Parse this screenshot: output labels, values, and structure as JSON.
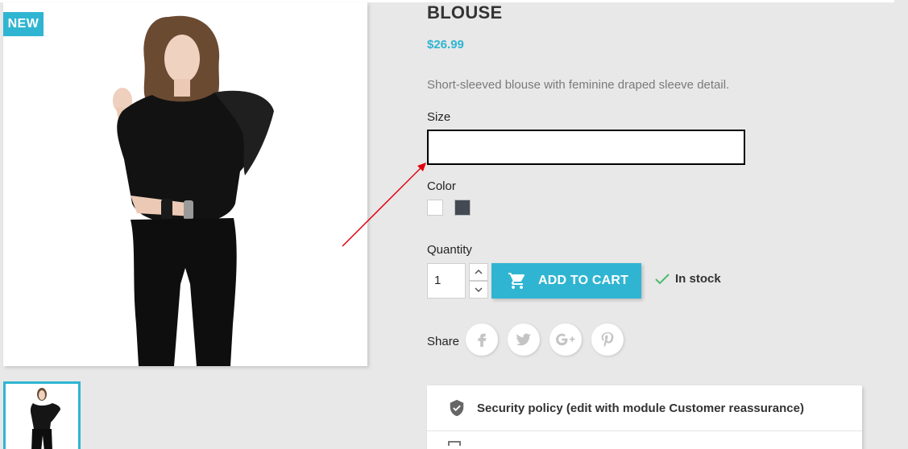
{
  "product": {
    "flag": "NEW",
    "title": "BLOUSE",
    "price": "$26.99",
    "short_description": "Short-sleeved blouse with feminine draped sleeve detail."
  },
  "variants": {
    "size_label": "Size",
    "size_value": "",
    "color_label": "Color",
    "colors": [
      {
        "name": "white",
        "hex": "#ffffff"
      },
      {
        "name": "dark-grey",
        "hex": "#434a54"
      }
    ]
  },
  "purchase": {
    "quantity_label": "Quantity",
    "quantity_value": "1",
    "add_to_cart_label": "ADD TO CART",
    "stock_status": "In stock"
  },
  "share": {
    "label": "Share",
    "networks": [
      "facebook-icon",
      "twitter-icon",
      "google-plus-icon",
      "pinterest-icon"
    ]
  },
  "reassurance": {
    "items": [
      {
        "text": "Security policy (edit with module Customer reassurance)",
        "icon": "shield-icon"
      }
    ]
  },
  "theme": {
    "accent": "#2fb5d2",
    "background": "#e8e8e8",
    "stock_check": "#4cbb6c",
    "annotation_arrow": "#e3000f"
  }
}
